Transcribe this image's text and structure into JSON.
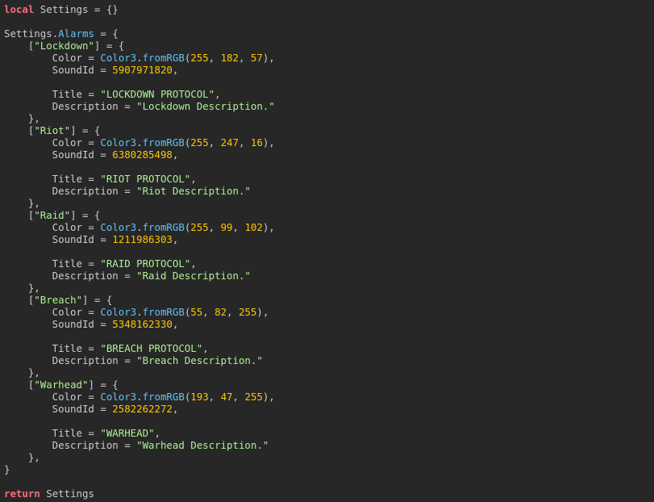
{
  "code_lines": [
    [
      {
        "t": "local",
        "c": "kw"
      },
      {
        "t": " ",
        "c": "p"
      },
      {
        "t": "Settings",
        "c": "id"
      },
      {
        "t": " = {}",
        "c": "p"
      }
    ],
    [],
    [
      {
        "t": "Settings",
        "c": "id"
      },
      {
        "t": ".",
        "c": "p"
      },
      {
        "t": "Alarms",
        "c": "fld"
      },
      {
        "t": " = {",
        "c": "p"
      }
    ],
    [
      {
        "t": "    [",
        "c": "p"
      },
      {
        "t": "\"Lockdown\"",
        "c": "str"
      },
      {
        "t": "] = {",
        "c": "p"
      }
    ],
    [
      {
        "t": "        Color = ",
        "c": "p"
      },
      {
        "t": "Color3",
        "c": "fld"
      },
      {
        "t": ".",
        "c": "p"
      },
      {
        "t": "fromRGB",
        "c": "fld"
      },
      {
        "t": "(",
        "c": "p"
      },
      {
        "t": "255",
        "c": "num"
      },
      {
        "t": ", ",
        "c": "p"
      },
      {
        "t": "182",
        "c": "num"
      },
      {
        "t": ", ",
        "c": "p"
      },
      {
        "t": "57",
        "c": "num"
      },
      {
        "t": "),",
        "c": "p"
      }
    ],
    [
      {
        "t": "        SoundId = ",
        "c": "p"
      },
      {
        "t": "5907971820",
        "c": "num"
      },
      {
        "t": ",",
        "c": "p"
      }
    ],
    [],
    [
      {
        "t": "        Title = ",
        "c": "p"
      },
      {
        "t": "\"LOCKDOWN PROTOCOL\"",
        "c": "str"
      },
      {
        "t": ",",
        "c": "p"
      }
    ],
    [
      {
        "t": "        Description = ",
        "c": "p"
      },
      {
        "t": "\"Lockdown Description.\"",
        "c": "str"
      }
    ],
    [
      {
        "t": "    },",
        "c": "p"
      }
    ],
    [
      {
        "t": "    [",
        "c": "p"
      },
      {
        "t": "\"Riot\"",
        "c": "str"
      },
      {
        "t": "] = {",
        "c": "p"
      }
    ],
    [
      {
        "t": "        Color = ",
        "c": "p"
      },
      {
        "t": "Color3",
        "c": "fld"
      },
      {
        "t": ".",
        "c": "p"
      },
      {
        "t": "fromRGB",
        "c": "fld"
      },
      {
        "t": "(",
        "c": "p"
      },
      {
        "t": "255",
        "c": "num"
      },
      {
        "t": ", ",
        "c": "p"
      },
      {
        "t": "247",
        "c": "num"
      },
      {
        "t": ", ",
        "c": "p"
      },
      {
        "t": "16",
        "c": "num"
      },
      {
        "t": "),",
        "c": "p"
      }
    ],
    [
      {
        "t": "        SoundId = ",
        "c": "p"
      },
      {
        "t": "6380285498",
        "c": "num"
      },
      {
        "t": ",",
        "c": "p"
      }
    ],
    [],
    [
      {
        "t": "        Title = ",
        "c": "p"
      },
      {
        "t": "\"RIOT PROTOCOL\"",
        "c": "str"
      },
      {
        "t": ",",
        "c": "p"
      }
    ],
    [
      {
        "t": "        Description = ",
        "c": "p"
      },
      {
        "t": "\"Riot Description.\"",
        "c": "str"
      }
    ],
    [
      {
        "t": "    },",
        "c": "p"
      }
    ],
    [
      {
        "t": "    [",
        "c": "p"
      },
      {
        "t": "\"Raid\"",
        "c": "str"
      },
      {
        "t": "] = {",
        "c": "p"
      }
    ],
    [
      {
        "t": "        Color = ",
        "c": "p"
      },
      {
        "t": "Color3",
        "c": "fld"
      },
      {
        "t": ".",
        "c": "p"
      },
      {
        "t": "fromRGB",
        "c": "fld"
      },
      {
        "t": "(",
        "c": "p"
      },
      {
        "t": "255",
        "c": "num"
      },
      {
        "t": ", ",
        "c": "p"
      },
      {
        "t": "99",
        "c": "num"
      },
      {
        "t": ", ",
        "c": "p"
      },
      {
        "t": "102",
        "c": "num"
      },
      {
        "t": "),",
        "c": "p"
      }
    ],
    [
      {
        "t": "        SoundId = ",
        "c": "p"
      },
      {
        "t": "1211986303",
        "c": "num"
      },
      {
        "t": ",",
        "c": "p"
      }
    ],
    [],
    [
      {
        "t": "        Title = ",
        "c": "p"
      },
      {
        "t": "\"RAID PROTOCOL\"",
        "c": "str"
      },
      {
        "t": ",",
        "c": "p"
      }
    ],
    [
      {
        "t": "        Description = ",
        "c": "p"
      },
      {
        "t": "\"Raid Description.\"",
        "c": "str"
      }
    ],
    [
      {
        "t": "    },",
        "c": "p"
      }
    ],
    [
      {
        "t": "    [",
        "c": "p"
      },
      {
        "t": "\"Breach\"",
        "c": "str"
      },
      {
        "t": "] = {",
        "c": "p"
      }
    ],
    [
      {
        "t": "        Color = ",
        "c": "p"
      },
      {
        "t": "Color3",
        "c": "fld"
      },
      {
        "t": ".",
        "c": "p"
      },
      {
        "t": "fromRGB",
        "c": "fld"
      },
      {
        "t": "(",
        "c": "p"
      },
      {
        "t": "55",
        "c": "num"
      },
      {
        "t": ", ",
        "c": "p"
      },
      {
        "t": "82",
        "c": "num"
      },
      {
        "t": ", ",
        "c": "p"
      },
      {
        "t": "255",
        "c": "num"
      },
      {
        "t": "),",
        "c": "p"
      }
    ],
    [
      {
        "t": "        SoundId = ",
        "c": "p"
      },
      {
        "t": "5348162330",
        "c": "num"
      },
      {
        "t": ",",
        "c": "p"
      }
    ],
    [],
    [
      {
        "t": "        Title = ",
        "c": "p"
      },
      {
        "t": "\"BREACH PROTOCOL\"",
        "c": "str"
      },
      {
        "t": ",",
        "c": "p"
      }
    ],
    [
      {
        "t": "        Description = ",
        "c": "p"
      },
      {
        "t": "\"Breach Description.\"",
        "c": "str"
      }
    ],
    [
      {
        "t": "    },",
        "c": "p"
      }
    ],
    [
      {
        "t": "    [",
        "c": "p"
      },
      {
        "t": "\"Warhead\"",
        "c": "str"
      },
      {
        "t": "] = {",
        "c": "p"
      }
    ],
    [
      {
        "t": "        Color = ",
        "c": "p"
      },
      {
        "t": "Color3",
        "c": "fld"
      },
      {
        "t": ".",
        "c": "p"
      },
      {
        "t": "fromRGB",
        "c": "fld"
      },
      {
        "t": "(",
        "c": "p"
      },
      {
        "t": "193",
        "c": "num"
      },
      {
        "t": ", ",
        "c": "p"
      },
      {
        "t": "47",
        "c": "num"
      },
      {
        "t": ", ",
        "c": "p"
      },
      {
        "t": "255",
        "c": "num"
      },
      {
        "t": "),",
        "c": "p"
      }
    ],
    [
      {
        "t": "        SoundId = ",
        "c": "p"
      },
      {
        "t": "2582262272",
        "c": "num"
      },
      {
        "t": ",",
        "c": "p"
      }
    ],
    [],
    [
      {
        "t": "        Title = ",
        "c": "p"
      },
      {
        "t": "\"WARHEAD\"",
        "c": "str"
      },
      {
        "t": ",",
        "c": "p"
      }
    ],
    [
      {
        "t": "        Description = ",
        "c": "p"
      },
      {
        "t": "\"Warhead Description.\"",
        "c": "str"
      }
    ],
    [
      {
        "t": "    },",
        "c": "p"
      }
    ],
    [
      {
        "t": "}",
        "c": "p"
      }
    ],
    [],
    [
      {
        "t": "return",
        "c": "kw"
      },
      {
        "t": " ",
        "c": "p"
      },
      {
        "t": "Settings",
        "c": "id"
      }
    ]
  ]
}
